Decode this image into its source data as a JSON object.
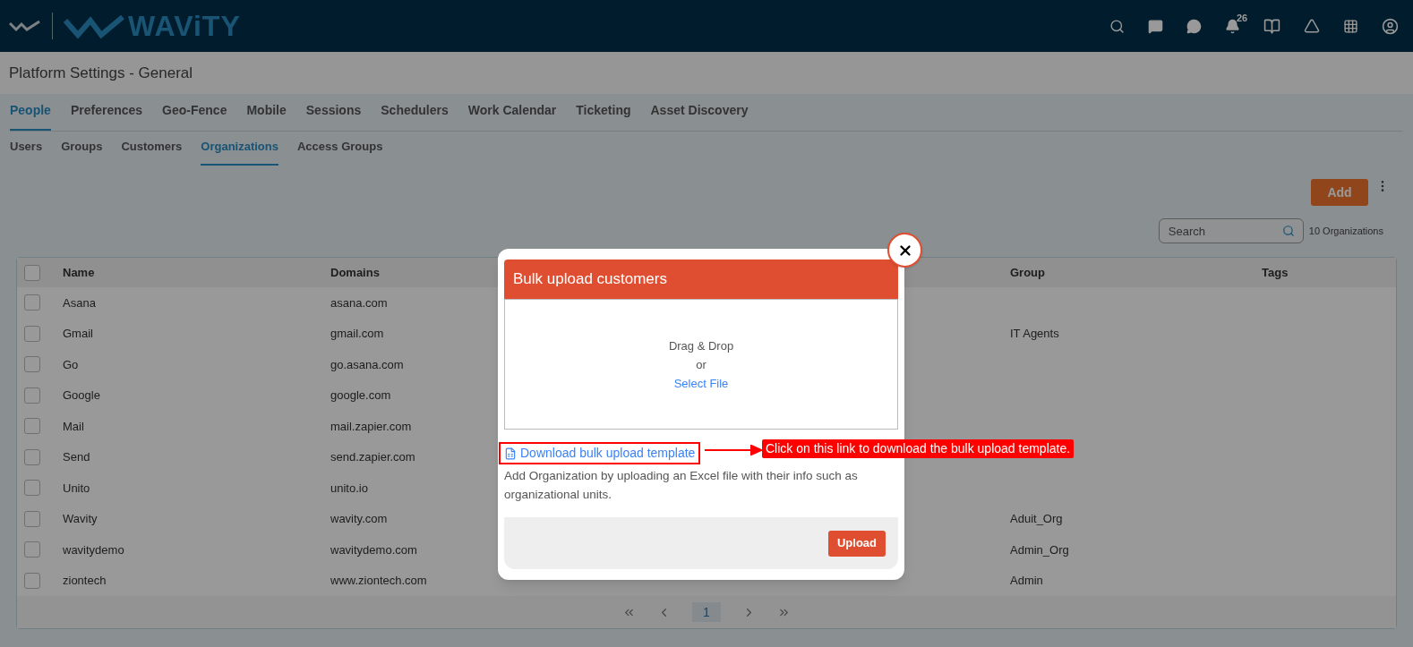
{
  "header": {
    "logo_text": "WAViTY",
    "notification_count": "26"
  },
  "page_title": "Platform Settings - General",
  "tabs": [
    {
      "label": "People",
      "selected": true
    },
    {
      "label": "Preferences",
      "selected": false
    },
    {
      "label": "Geo-Fence",
      "selected": false
    },
    {
      "label": "Mobile",
      "selected": false
    },
    {
      "label": "Sessions",
      "selected": false
    },
    {
      "label": "Schedulers",
      "selected": false
    },
    {
      "label": "Work Calendar",
      "selected": false
    },
    {
      "label": "Ticketing",
      "selected": false
    },
    {
      "label": "Asset Discovery",
      "selected": false
    }
  ],
  "subtabs": [
    {
      "label": "Users",
      "selected": false
    },
    {
      "label": "Groups",
      "selected": false
    },
    {
      "label": "Customers",
      "selected": false
    },
    {
      "label": "Organizations",
      "selected": true
    },
    {
      "label": "Access Groups",
      "selected": false
    }
  ],
  "toolbar": {
    "add_button": "Add",
    "search": {
      "placeholder": "Search"
    },
    "count": "10 Organizations"
  },
  "table": {
    "header": {
      "selected": false,
      "name": "Name",
      "domains": "Domains",
      "group": "Group",
      "tags": "Tags"
    },
    "rows": [
      {
        "selected": false,
        "name": "Asana",
        "domains": "asana.com"
      },
      {
        "selected": false,
        "name": "Gmail",
        "domains": "gmail.com",
        "group": "IT Agents"
      },
      {
        "selected": false,
        "name": "Go",
        "domains": "go.asana.com"
      },
      {
        "selected": false,
        "name": "Google",
        "domains": "google.com"
      },
      {
        "selected": false,
        "name": "Mail",
        "domains": "mail.zapier.com"
      },
      {
        "selected": false,
        "name": "Send",
        "domains": "send.zapier.com"
      },
      {
        "selected": false,
        "name": "Unito",
        "domains": "unito.io"
      },
      {
        "selected": false,
        "name": "Wavity",
        "domains": "wavity.com",
        "group": "Aduit_Org"
      },
      {
        "selected": false,
        "name": "wavitydemo",
        "domains": "wavitydemo.com",
        "group": "Admin_Org"
      },
      {
        "selected": false,
        "name": "ziontech",
        "domains": "www.ziontech.com",
        "group": "Admin"
      }
    ]
  },
  "pagination": {
    "pages": [
      {
        "label": "1",
        "selected": true
      }
    ]
  },
  "modal": {
    "title": "Bulk upload customers",
    "dropzone": {
      "line_1": "Drag & Drop",
      "line_2": "or",
      "select_link": "Select File"
    },
    "template_link": "Download bulk upload template",
    "description": "Add Organization by uploading an Excel file with their info such as organizational units.",
    "upload_button": "Upload"
  },
  "annotation": {
    "callout": "Click on this link to download the bulk upload template."
  }
}
